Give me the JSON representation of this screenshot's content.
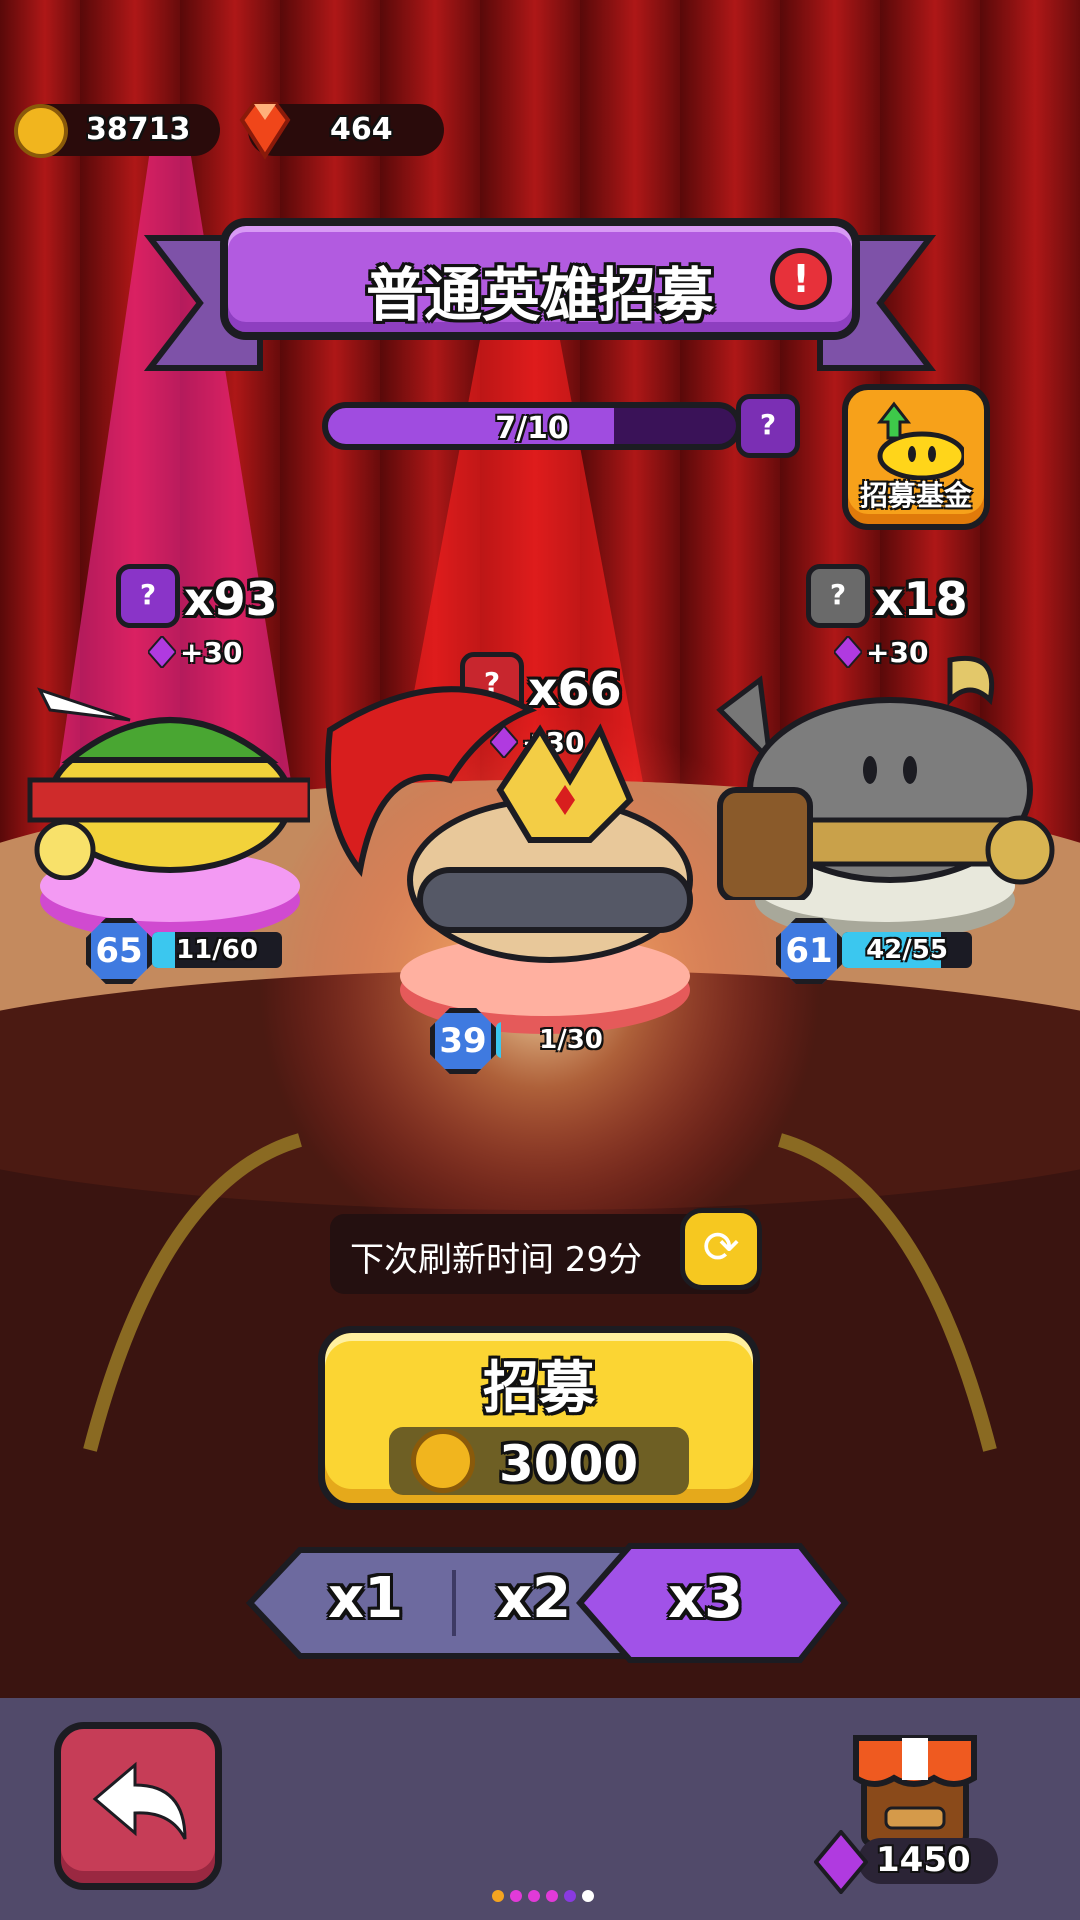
{
  "currency": {
    "coins": "38713",
    "gems": "464"
  },
  "title": "普通英雄招募",
  "progress": {
    "text": "7/10",
    "fraction": 0.7,
    "reward_icon": "?"
  },
  "fund_button": {
    "label": "招募基金"
  },
  "heroes": [
    {
      "mystery": "?",
      "count": "x93",
      "bonus": "+30",
      "level": "65",
      "xp": "11/60",
      "xp_fraction": 0.18
    },
    {
      "mystery": "?",
      "count": "x66",
      "bonus": "+30",
      "level": "39",
      "xp": "1/30",
      "xp_fraction": 0.03
    },
    {
      "mystery": "?",
      "count": "x18",
      "bonus": "+30",
      "level": "61",
      "xp": "42/55",
      "xp_fraction": 0.76
    }
  ],
  "refresh": {
    "label": "下次刷新时间  29分"
  },
  "recruit": {
    "label": "招募",
    "cost": "3000"
  },
  "multipliers": [
    "x1",
    "x2",
    "x3"
  ],
  "selected_multiplier": "x3",
  "shop": {
    "gems": "1450"
  },
  "colors": {
    "accent": "#b25be0",
    "button_yellow": "#fbd533",
    "level_blue": "#3f7ae0",
    "xp_cyan": "#3bc7ef"
  }
}
